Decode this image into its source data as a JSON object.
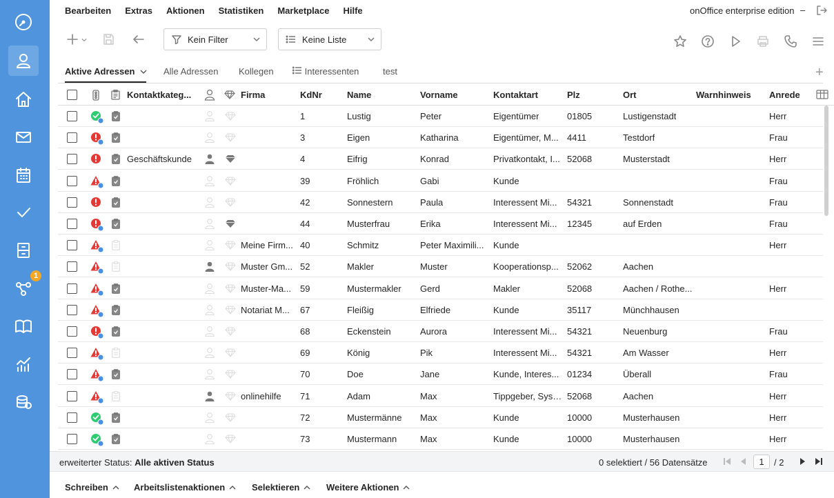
{
  "menu": [
    "Bearbeiten",
    "Extras",
    "Aktionen",
    "Statistiken",
    "Marketplace",
    "Hilfe"
  ],
  "edition": "onOffice enterprise edition",
  "edition_min": "–",
  "sidebar": {
    "items": [
      "dashboard-icon",
      "contacts-icon",
      "home-icon",
      "mail-icon",
      "calendar-icon",
      "tasks-icon",
      "archive-icon",
      "workflow-icon",
      "book-icon",
      "stats-icon",
      "database-icon"
    ],
    "badge": "1"
  },
  "toolbar": {
    "filter_label": "Kein Filter",
    "list_label": "Keine Liste"
  },
  "tabs": [
    "Aktive Adressen",
    "Alle Adressen",
    "Kollegen",
    "Interessenten",
    "test"
  ],
  "columns": {
    "kontaktkategorie": "Kontaktkateg...",
    "firma": "Firma",
    "kdnr": "KdNr",
    "name": "Name",
    "vorname": "Vorname",
    "kontaktart": "Kontaktart",
    "plz": "Plz",
    "ort": "Ort",
    "warnhinweis": "Warnhinweis",
    "anrede": "Anrede"
  },
  "rows": [
    {
      "status": "ok",
      "clip": true,
      "person": false,
      "gem": false,
      "kat": "",
      "firma": "",
      "kdnr": "1",
      "name": "Lustig",
      "vorname": "Peter",
      "kontaktart": "Eigentümer",
      "plz": "01805",
      "ort": "Lustigenstadt",
      "anrede": "Herr"
    },
    {
      "status": "error",
      "clip": true,
      "person": false,
      "gem": false,
      "kat": "",
      "firma": "",
      "kdnr": "3",
      "name": "Eigen",
      "vorname": "Katharina",
      "kontaktart": "Eigentümer, M...",
      "plz": "4411",
      "ort": "Testdorf",
      "anrede": "Frau"
    },
    {
      "status": "error-plain",
      "clip": true,
      "person": true,
      "gem": true,
      "kat": "Geschäftskunde",
      "firma": "",
      "kdnr": "4",
      "name": "Eifrig",
      "vorname": "Konrad",
      "kontaktart": "Privatkontakt, I...",
      "plz": "52068",
      "ort": "Musterstadt",
      "anrede": "Herr"
    },
    {
      "status": "warn",
      "clip": true,
      "person": false,
      "gem": false,
      "kat": "",
      "firma": "",
      "kdnr": "39",
      "name": "Fröhlich",
      "vorname": "Gabi",
      "kontaktart": "Kunde",
      "plz": "",
      "ort": "",
      "anrede": "Frau"
    },
    {
      "status": "error-plain",
      "clip": true,
      "person": false,
      "gem": false,
      "kat": "",
      "firma": "",
      "kdnr": "42",
      "name": "Sonnestern",
      "vorname": "Paula",
      "kontaktart": "Interessent Mi...",
      "plz": "54321",
      "ort": "Sonnenstadt",
      "anrede": "Frau"
    },
    {
      "status": "error",
      "clip": true,
      "person": false,
      "gem": true,
      "kat": "",
      "firma": "",
      "kdnr": "44",
      "name": "Musterfrau",
      "vorname": "Erika",
      "kontaktart": "Interessent Mi...",
      "plz": "12345",
      "ort": "auf Erden",
      "anrede": "Frau"
    },
    {
      "status": "warn",
      "clip": false,
      "person": false,
      "gem": false,
      "kat": "",
      "firma": "Meine Firm...",
      "kdnr": "40",
      "name": "Schmitz",
      "vorname": "Peter Maximili...",
      "kontaktart": "Kunde",
      "plz": "",
      "ort": "",
      "anrede": "Herr"
    },
    {
      "status": "warn",
      "clip": false,
      "person": true,
      "gem": false,
      "kat": "",
      "firma": "Muster Gm...",
      "kdnr": "52",
      "name": "Makler",
      "vorname": "Muster",
      "kontaktart": "Kooperationsp...",
      "plz": "52062",
      "ort": "Aachen",
      "anrede": ""
    },
    {
      "status": "warn",
      "clip": true,
      "person": false,
      "gem": false,
      "kat": "",
      "firma": "Muster-Ma...",
      "kdnr": "59",
      "name": "Mustermakler",
      "vorname": "Gerd",
      "kontaktart": "Makler",
      "plz": "52068",
      "ort": "Aachen / Rothe...",
      "anrede": "Herr"
    },
    {
      "status": "warn",
      "clip": true,
      "person": false,
      "gem": false,
      "kat": "",
      "firma": "Notariat M...",
      "kdnr": "67",
      "name": "Fleißig",
      "vorname": "Elfriede",
      "kontaktart": "Kunde",
      "plz": "35117",
      "ort": "Münchhausen",
      "anrede": ""
    },
    {
      "status": "error",
      "clip": true,
      "person": false,
      "gem": false,
      "kat": "",
      "firma": "",
      "kdnr": "68",
      "name": "Eckenstein",
      "vorname": "Aurora",
      "kontaktart": "Interessent Mi...",
      "plz": "54321",
      "ort": "Neuenburg",
      "anrede": "Frau"
    },
    {
      "status": "warn",
      "clip": false,
      "person": false,
      "gem": false,
      "kat": "",
      "firma": "",
      "kdnr": "69",
      "name": "König",
      "vorname": "Pik",
      "kontaktart": "Interessent Mi...",
      "plz": "54321",
      "ort": "Am Wasser",
      "anrede": "Herr"
    },
    {
      "status": "warn",
      "clip": true,
      "person": false,
      "gem": false,
      "kat": "",
      "firma": "",
      "kdnr": "70",
      "name": "Doe",
      "vorname": "Jane",
      "kontaktart": "Kunde, Interes...",
      "plz": "01234",
      "ort": "Überall",
      "anrede": "Frau"
    },
    {
      "status": "warn",
      "clip": false,
      "person": true,
      "gem": false,
      "kat": "",
      "firma": "onlinehilfe",
      "kdnr": "71",
      "name": "Adam",
      "vorname": "Max",
      "kontaktart": "Tippgeber, Syst...",
      "plz": "52068",
      "ort": "Aachen",
      "anrede": "Herr"
    },
    {
      "status": "ok",
      "clip": true,
      "person": false,
      "gem": false,
      "kat": "",
      "firma": "",
      "kdnr": "72",
      "name": "Mustermänne",
      "vorname": "Max",
      "kontaktart": "Kunde",
      "plz": "10000",
      "ort": "Musterhausen",
      "anrede": "Herr"
    },
    {
      "status": "ok",
      "clip": true,
      "person": false,
      "gem": false,
      "kat": "",
      "firma": "",
      "kdnr": "73",
      "name": "Mustermann",
      "vorname": "Max",
      "kontaktart": "Kunde",
      "plz": "10000",
      "ort": "Musterhausen",
      "anrede": "Herr"
    }
  ],
  "statusbar": {
    "label": "erweiterter Status:",
    "value": "Alle aktiven Status",
    "count": "0 selektiert / 56 Datensätze",
    "page": "1",
    "total": "/ 2"
  },
  "bottombar": [
    "Schreiben",
    "Arbeitslistenaktionen",
    "Selektieren",
    "Weitere Aktionen"
  ],
  "colors": {
    "sidebar": "#4f94dd",
    "ok": "#2ecc71",
    "error": "#e53935",
    "badge": "#f5a623",
    "dot": "#4a90e2"
  }
}
